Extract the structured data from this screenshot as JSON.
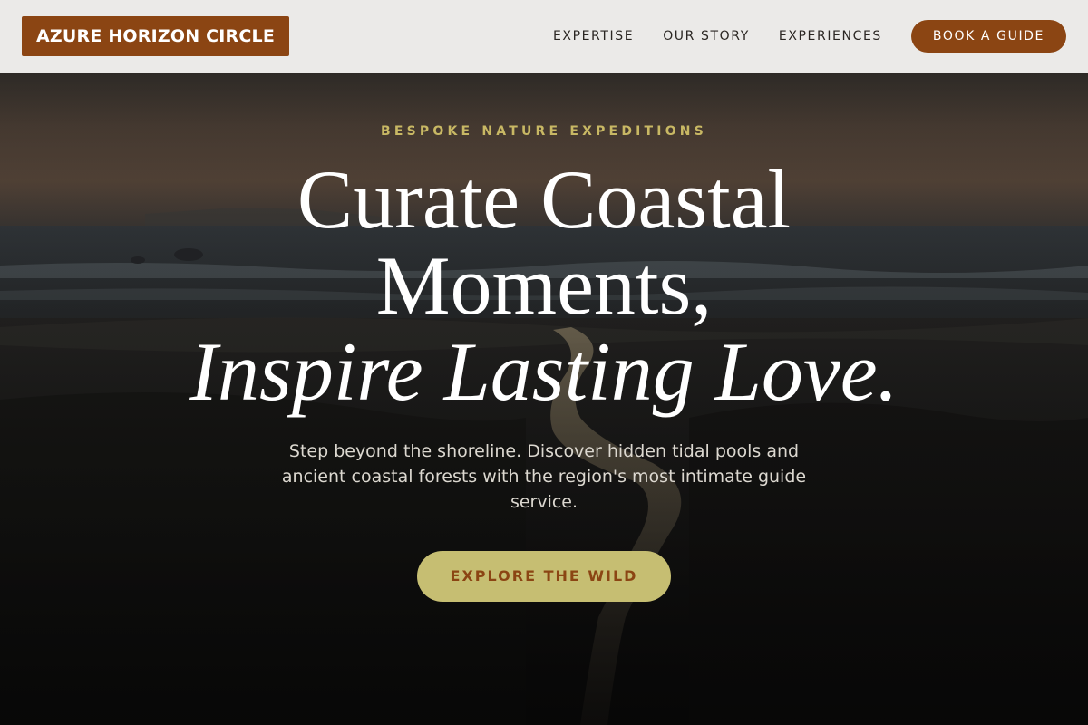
{
  "header": {
    "logo": "AZURE HORIZON CIRCLE",
    "nav": [
      {
        "label": "EXPERTISE"
      },
      {
        "label": "OUR STORY"
      },
      {
        "label": "EXPERIENCES"
      }
    ],
    "cta_label": "BOOK A GUIDE"
  },
  "hero": {
    "eyebrow": "BESPOKE NATURE EXPEDITIONS",
    "headline_line1": "Curate Coastal",
    "headline_line2": "Moments,",
    "headline_line3": "Inspire Lasting Love.",
    "subtitle": "Step beyond the shoreline. Discover hidden tidal pools and ancient coastal forests with the region's most intimate guide service.",
    "button_label": "EXPLORE THE WILD"
  },
  "colors": {
    "brand": "#8b4513",
    "accent": "#c6be72",
    "eyebrow": "#c8b864",
    "header_bg": "#ebeae8"
  }
}
